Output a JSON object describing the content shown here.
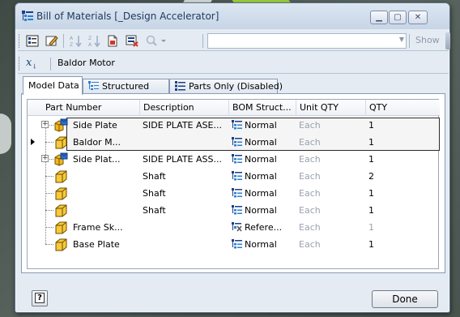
{
  "window": {
    "title": "Bill of Materials [_Design Accelerator]"
  },
  "toolbar": {
    "show_label": "Show",
    "filter_value": ""
  },
  "expression_bar": {
    "value": "Baldor Motor"
  },
  "tabs": [
    {
      "label": "Model Data",
      "active": true
    },
    {
      "label": "Structured",
      "active": false
    },
    {
      "label": "Parts Only (Disabled)",
      "active": false
    }
  ],
  "grid": {
    "columns": [
      "Part Number",
      "Description",
      "BOM Struct...",
      "Unit QTY",
      "QTY"
    ],
    "rows": [
      {
        "part": "Side Plate",
        "description": "SIDE PLATE ASE...",
        "bom": "Normal",
        "unit": "Each",
        "qty": "1",
        "type": "assembly",
        "expandable": true,
        "selected": true,
        "current": false
      },
      {
        "part": "Baldor M...",
        "description": "",
        "bom": "Normal",
        "unit": "Each",
        "qty": "1",
        "type": "part",
        "expandable": false,
        "selected": true,
        "current": true
      },
      {
        "part": "Side Plat...",
        "description": "SIDE PLATE ASS...",
        "bom": "Normal",
        "unit": "Each",
        "qty": "1",
        "type": "assembly",
        "expandable": true,
        "selected": false,
        "current": false
      },
      {
        "part": "",
        "description": "Shaft",
        "bom": "Normal",
        "unit": "Each",
        "qty": "2",
        "type": "part",
        "expandable": false,
        "selected": false,
        "current": false
      },
      {
        "part": "",
        "description": "Shaft",
        "bom": "Normal",
        "unit": "Each",
        "qty": "1",
        "type": "part",
        "expandable": false,
        "selected": false,
        "current": false
      },
      {
        "part": "",
        "description": "Shaft",
        "bom": "Normal",
        "unit": "Each",
        "qty": "1",
        "type": "part",
        "expandable": false,
        "selected": false,
        "current": false
      },
      {
        "part": "Frame Sk...",
        "description": "",
        "bom": "Refere...",
        "unit": "Each",
        "qty": "1",
        "type": "part",
        "expandable": false,
        "selected": false,
        "current": false,
        "bom_type": "reference",
        "qty_muted": true
      },
      {
        "part": "Base Plate",
        "description": "",
        "bom": "Normal",
        "unit": "Each",
        "qty": "1",
        "type": "part",
        "expandable": false,
        "selected": false,
        "current": false
      }
    ]
  },
  "footer": {
    "help_label": "?",
    "done_label": "Done"
  },
  "colors": {
    "accent": "#1e395b",
    "muted_text": "#9aa3ae",
    "selection_border": "#2b2b2b"
  }
}
